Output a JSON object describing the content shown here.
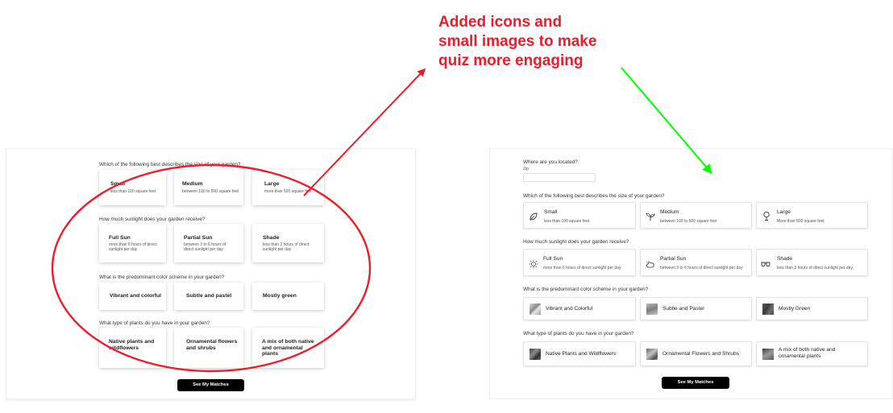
{
  "annotation": {
    "note_lines": [
      "Added icons and",
      "small images to make",
      "quiz more engaging"
    ],
    "note_color": "#ee1c2a",
    "arrow_right_color": "#00ff00"
  },
  "left": {
    "q_size": "Which of the following best describes the size of your garden?",
    "size_options": [
      {
        "title": "Small",
        "sub": "less than 100 square feet"
      },
      {
        "title": "Medium",
        "sub": "between 100 to 500 square feet"
      },
      {
        "title": "Large",
        "sub": "more than 500 square feet"
      }
    ],
    "q_sun": "How much sunlight does your garden receive?",
    "sun_options": [
      {
        "title": "Full Sun",
        "sub": "more than 6 hours of direct sunlight per day"
      },
      {
        "title": "Partial Sun",
        "sub": "between 3 to 6 hours of direct sunlight per day"
      },
      {
        "title": "Shade",
        "sub": "less than 3 hours of direct sunlight per day"
      }
    ],
    "q_color": "What is the predominant color scheme in your garden?",
    "color_options": [
      "Vibrant and colorful",
      "Subtle and pastel",
      "Mostly green"
    ],
    "q_plants": "What type of plants do you have in your garden?",
    "plant_options": [
      "Native plants and wildflowers",
      "Ornamental flowers and shrubs",
      "A mix of both native and ornamental plants"
    ],
    "button": "See My Matches"
  },
  "right": {
    "q_location": "Where are you located?",
    "zip_label": "Zip",
    "zip_value": "",
    "q_size": "Which of the following best describes the size of your garden?",
    "size_options": [
      {
        "title": "Small",
        "sub": "less than 100 square feet",
        "icon": "leaf-icon"
      },
      {
        "title": "Medium",
        "sub": "between 100 to 500 square feet",
        "icon": "sprout-icon"
      },
      {
        "title": "Large",
        "sub": "More than 500 square feet",
        "icon": "tree-icon"
      }
    ],
    "q_sun": "How much sunlight does your garden receive?",
    "sun_options": [
      {
        "title": "Full Sun",
        "sub": "more than 6 hours of direct sunlight per day",
        "icon": "sun-icon"
      },
      {
        "title": "Partial Sun",
        "sub": "between 3 to 6 hours of direct sunlight per day",
        "icon": "partial-sun-icon"
      },
      {
        "title": "Shade",
        "sub": "less than 3 hours of direct sunlight per day",
        "icon": "sunglasses-icon"
      }
    ],
    "q_color": "What is the predominant color scheme in your garden?",
    "color_options": [
      "Vibrant and Colorful",
      "Subtle and Pastel",
      "Mostly Green"
    ],
    "q_plants": "What type of plants do you have in your garden?",
    "plant_options": [
      "Native Plants and Wildflowers",
      "Ornamental Flowers and Shrubs",
      "A mix of both native and ornamental plants"
    ],
    "button": "See My Matches"
  }
}
